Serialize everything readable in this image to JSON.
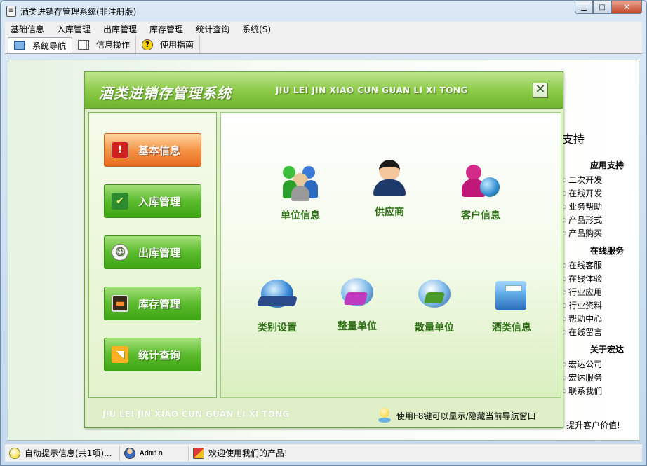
{
  "window": {
    "title": "酒类进销存管理系统(非注册版)",
    "app_icon": "document-icon",
    "min_symbol": "▁",
    "max_symbol": "□",
    "close_symbol": "✕"
  },
  "menubar": {
    "items": [
      {
        "label": "基础信息"
      },
      {
        "label": "入库管理"
      },
      {
        "label": "出库管理"
      },
      {
        "label": "库存管理"
      },
      {
        "label": "统计查询"
      },
      {
        "label": "系统(S)"
      }
    ]
  },
  "toolbar": {
    "tabs": [
      {
        "label": "系统导航",
        "icon": "monitor-icon",
        "active": true
      },
      {
        "label": "信息操作",
        "icon": "grid-icon",
        "active": false
      },
      {
        "label": "使用指南",
        "icon": "help-icon",
        "active": false
      }
    ],
    "help_glyph": "?"
  },
  "nav_dialog": {
    "title": "酒类进销存管理系统",
    "pinyin": "JIU LEI JIN XIAO CUN GUAN LI XI TONG",
    "close_symbol": "✕",
    "footer_pinyin": "JIU LEI JIN XIAO CUN GUAN LI XI TONG",
    "hint": "使用F8键可以显示/隐藏当前导航窗口",
    "side_buttons": [
      {
        "label": "基本信息",
        "icon": "alert-monitor-icon",
        "glyph": "!",
        "active": true
      },
      {
        "label": "入库管理",
        "icon": "check-inbox-icon",
        "glyph": "✔",
        "active": false
      },
      {
        "label": "出库管理",
        "icon": "chat-bubble-icon",
        "glyph": "☺",
        "active": false
      },
      {
        "label": "库存管理",
        "icon": "display-icon",
        "glyph": "▬",
        "active": false
      },
      {
        "label": "统计查询",
        "icon": "rss-icon",
        "glyph": "◥",
        "active": false
      }
    ],
    "grid_items": [
      {
        "label": "单位信息",
        "icon": "users-group-icon"
      },
      {
        "label": "供应商",
        "icon": "supplier-person-icon"
      },
      {
        "label": "客户信息",
        "icon": "customer-globe-icon"
      },
      {
        "label": "类别设置",
        "icon": "category-globe-icon"
      },
      {
        "label": "整量单位",
        "icon": "bulk-unit-icon"
      },
      {
        "label": "散量单位",
        "icon": "loose-unit-icon"
      },
      {
        "label": "酒类信息",
        "icon": "folder-info-icon"
      }
    ]
  },
  "support_panel": {
    "title": "支持",
    "sections": [
      {
        "heading": "应用支持",
        "links": [
          "二次开发",
          "在线开发",
          "业务帮助",
          "产品形式",
          "产品购买"
        ]
      },
      {
        "heading": "在线服务",
        "links": [
          "在线客服",
          "在线体验",
          "行业应用",
          "行业资料",
          "帮助中心",
          "在线留言"
        ]
      },
      {
        "heading": "关于宏达",
        "links": [
          "宏达公司",
          "宏达服务",
          "联系我们"
        ]
      }
    ],
    "footer": "提升客户价值!"
  },
  "statusbar": {
    "tip": "自动提示信息(共1项)...",
    "user": "Admin",
    "welcome": "欢迎使用我们的产品!"
  }
}
